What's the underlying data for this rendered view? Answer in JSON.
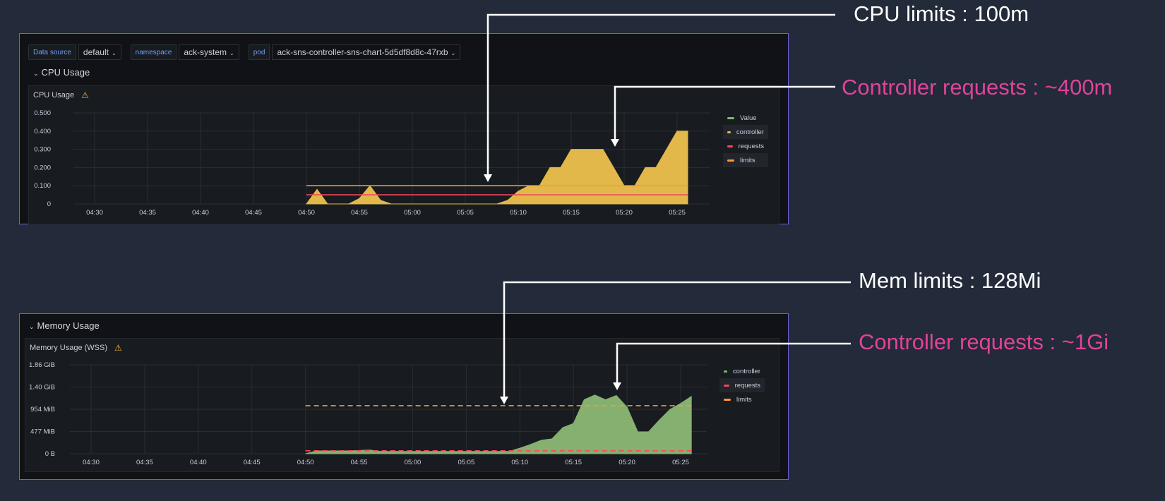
{
  "variables": [
    {
      "label": "Data source",
      "value": "default"
    },
    {
      "label": "namespace",
      "value": "ack-system"
    },
    {
      "label": "pod",
      "value": "ack-sns-controller-sns-chart-5d5df8d8c-47rxb"
    }
  ],
  "cpu_row_title": "CPU Usage",
  "mem_row_title": "Memory Usage",
  "callouts": {
    "cpu_limits": "CPU limits : 100m",
    "cpu_requests": "Controller requests : ~400m",
    "mem_limits": "Mem limits : 128Mi",
    "mem_requests": "Controller requests : ~1Gi"
  },
  "colors": {
    "background": "#232a39",
    "panel_border": "#6f5fd6",
    "callout_white": "#ffffff",
    "callout_pink": "#e0439b",
    "series_value": "#73bf69",
    "series_controller_cpu": "#e2b84a",
    "series_controller_mem": "#86b06f",
    "series_requests": "#f2495c",
    "series_limits": "#ff9830"
  },
  "chart_data": [
    {
      "type": "area",
      "title": "CPU Usage",
      "warning_icon": "warning-icon",
      "x_ticks": [
        "04:30",
        "04:35",
        "04:40",
        "04:45",
        "04:50",
        "04:55",
        "05:00",
        "05:05",
        "05:10",
        "05:15",
        "05:20",
        "05:25"
      ],
      "y_ticks": [
        "0.500",
        "0.400",
        "0.300",
        "0.200",
        "0.100",
        "0"
      ],
      "ylim": [
        0,
        0.5
      ],
      "legend": [
        {
          "name": "Value",
          "color": "#73bf69"
        },
        {
          "name": "controller",
          "color": "#e2b84a"
        },
        {
          "name": "requests",
          "color": "#f2495c"
        },
        {
          "name": "limits",
          "color": "#ff9830"
        }
      ],
      "series": [
        {
          "name": "controller",
          "kind": "area",
          "x": [
            "04:50",
            "04:51",
            "04:52",
            "04:53",
            "04:54",
            "04:55",
            "04:56",
            "04:57",
            "04:58",
            "04:59",
            "05:00",
            "05:01",
            "05:02",
            "05:03",
            "05:04",
            "05:05",
            "05:06",
            "05:07",
            "05:08",
            "05:09",
            "05:10",
            "05:11",
            "05:12",
            "05:13",
            "05:14",
            "05:15",
            "05:16",
            "05:17",
            "05:18",
            "05:19",
            "05:20",
            "05:21",
            "05:22",
            "05:23",
            "05:24",
            "05:25",
            "05:26"
          ],
          "values": [
            0,
            0.08,
            0,
            0,
            0,
            0.03,
            0.1,
            0.02,
            0,
            0,
            0,
            0,
            0,
            0,
            0,
            0,
            0,
            0,
            0,
            0.02,
            0.07,
            0.1,
            0.1,
            0.2,
            0.2,
            0.3,
            0.3,
            0.3,
            0.3,
            0.2,
            0.1,
            0.1,
            0.2,
            0.2,
            0.3,
            0.4,
            0.4
          ]
        },
        {
          "name": "requests",
          "kind": "line",
          "value": 0.05,
          "from": "04:50",
          "to": "05:26"
        },
        {
          "name": "limits",
          "kind": "line",
          "value": 0.1,
          "from": "04:50",
          "to": "05:26"
        }
      ]
    },
    {
      "type": "area",
      "title": "Memory Usage (WSS)",
      "warning_icon": "warning-icon",
      "x_ticks": [
        "04:30",
        "04:35",
        "04:40",
        "04:45",
        "04:50",
        "04:55",
        "05:00",
        "05:05",
        "05:10",
        "05:15",
        "05:20",
        "05:25"
      ],
      "y_ticks": [
        "1.86 GiB",
        "1.40 GiB",
        "954 MiB",
        "477 MiB",
        "0 B"
      ],
      "y_max_mib": 1908,
      "legend": [
        {
          "name": "controller",
          "color": "#73bf69"
        },
        {
          "name": "requests",
          "color": "#f2495c"
        },
        {
          "name": "limits",
          "color": "#ff9830"
        }
      ],
      "series": [
        {
          "name": "controller",
          "kind": "area",
          "unit": "MiB",
          "x": [
            "04:50",
            "04:51",
            "04:52",
            "04:53",
            "04:54",
            "04:55",
            "04:56",
            "04:57",
            "04:58",
            "04:59",
            "05:00",
            "05:01",
            "05:02",
            "05:03",
            "05:04",
            "05:05",
            "05:06",
            "05:07",
            "05:08",
            "05:09",
            "05:10",
            "05:11",
            "05:12",
            "05:13",
            "05:14",
            "05:15",
            "05:16",
            "05:17",
            "05:18",
            "05:19",
            "05:20",
            "05:21",
            "05:22",
            "05:23",
            "05:24",
            "05:25",
            "05:26"
          ],
          "values": [
            0,
            60,
            60,
            60,
            60,
            70,
            80,
            50,
            50,
            50,
            50,
            50,
            50,
            50,
            50,
            50,
            50,
            50,
            50,
            50,
            120,
            200,
            290,
            320,
            560,
            650,
            1160,
            1260,
            1160,
            1250,
            1000,
            470,
            470,
            720,
            950,
            1080,
            1230
          ]
        },
        {
          "name": "requests",
          "kind": "dashed",
          "value": 64,
          "from": "04:50",
          "to": "05:26"
        },
        {
          "name": "limits",
          "kind": "dashed",
          "value": 1030,
          "from": "04:50",
          "to": "05:26"
        }
      ]
    }
  ]
}
